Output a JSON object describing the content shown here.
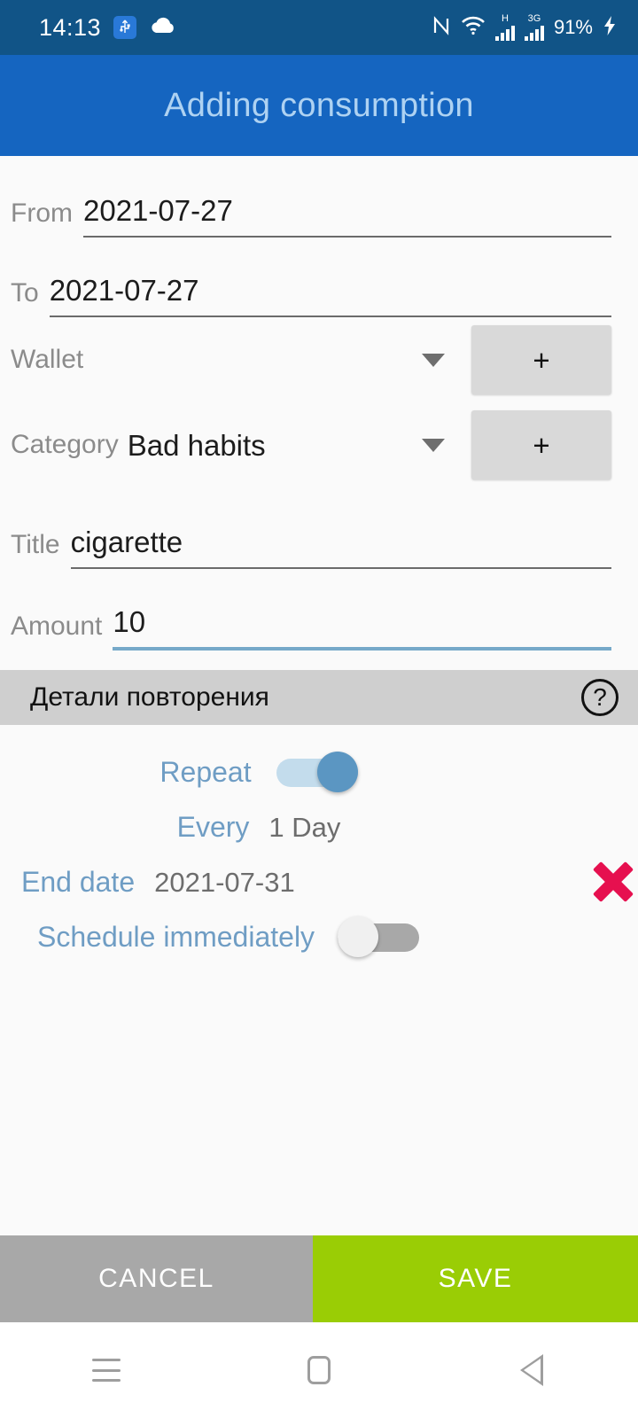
{
  "status_bar": {
    "time": "14:13",
    "usb_icon": "usb-icon",
    "cloud_icon": "cloud-icon",
    "nfc_icon": "nfc-icon",
    "wifi_icon": "wifi-icon",
    "network_1_label": "H",
    "network_2_label": "3G",
    "battery_percent": "91%",
    "charging_icon": "charging-bolt-icon",
    "background_color": "#115487"
  },
  "app_bar": {
    "title": "Adding consumption",
    "background_color": "#1565c0",
    "title_color": "#aed2f2"
  },
  "form": {
    "from": {
      "label": "From",
      "value": "2021-07-27"
    },
    "to": {
      "label": "To",
      "value": "2021-07-27"
    },
    "wallet": {
      "label": "Wallet",
      "value": "",
      "add_label": "+"
    },
    "category": {
      "label": "Category",
      "value": "Bad habits",
      "add_label": "+"
    },
    "title": {
      "label": "Title",
      "value": "cigarette"
    },
    "amount": {
      "label": "Amount",
      "value": "10",
      "focused_underline_color": "#76a9c9"
    }
  },
  "repeat_section": {
    "header": "Детали повторения",
    "help_icon": "?",
    "repeat": {
      "label": "Repeat",
      "state": "on"
    },
    "every": {
      "label": "Every",
      "value": "1 Day"
    },
    "end_date": {
      "label": "End date",
      "value": "2021-07-31",
      "clear_icon": "close-x-icon",
      "clear_color": "#e6104f"
    },
    "schedule_immediately": {
      "label": "Schedule immediately",
      "state": "off"
    }
  },
  "actions": {
    "cancel_label": "CANCEL",
    "cancel_color": "#a8a8a8",
    "save_label": "SAVE",
    "save_color": "#9acd05"
  },
  "nav_bar": {
    "recents_icon": "recents-icon",
    "home_icon": "home-icon",
    "back_icon": "back-icon"
  }
}
